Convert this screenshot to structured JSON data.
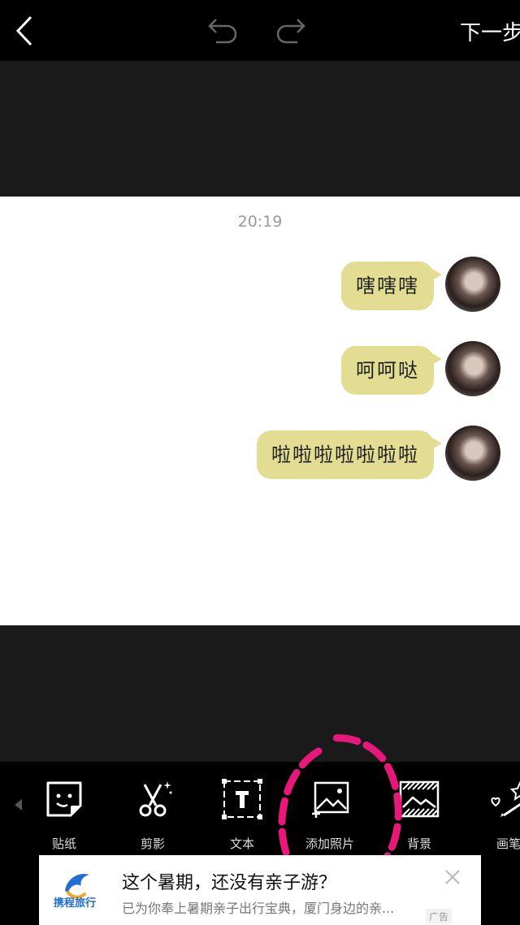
{
  "header": {
    "next_label": "下一步"
  },
  "chat": {
    "timestamp": "20:19",
    "messages": [
      {
        "text": "嗐嗐嗐"
      },
      {
        "text": "呵呵哒"
      },
      {
        "text": "啦啦啦啦啦啦啦"
      }
    ]
  },
  "toolbar": {
    "items": [
      {
        "label": "贴纸",
        "icon": "sticker-icon"
      },
      {
        "label": "剪影",
        "icon": "scissors-icon"
      },
      {
        "label": "文本",
        "icon": "text-icon"
      },
      {
        "label": "添加照片",
        "icon": "add-photo-icon"
      },
      {
        "label": "背景",
        "icon": "background-icon"
      },
      {
        "label": "画笔",
        "icon": "brush-icon"
      }
    ]
  },
  "ad": {
    "brand": "携程旅行",
    "headline": "这个暑期，还没有亲子游？",
    "subtitle": "已为你奉上暑期亲子出行宝典，厦门身边的亲...",
    "tag": "广告"
  },
  "colors": {
    "bubble": "#e3dc93",
    "annotation": "#e8177a",
    "brand_blue": "#1f6fd0"
  }
}
